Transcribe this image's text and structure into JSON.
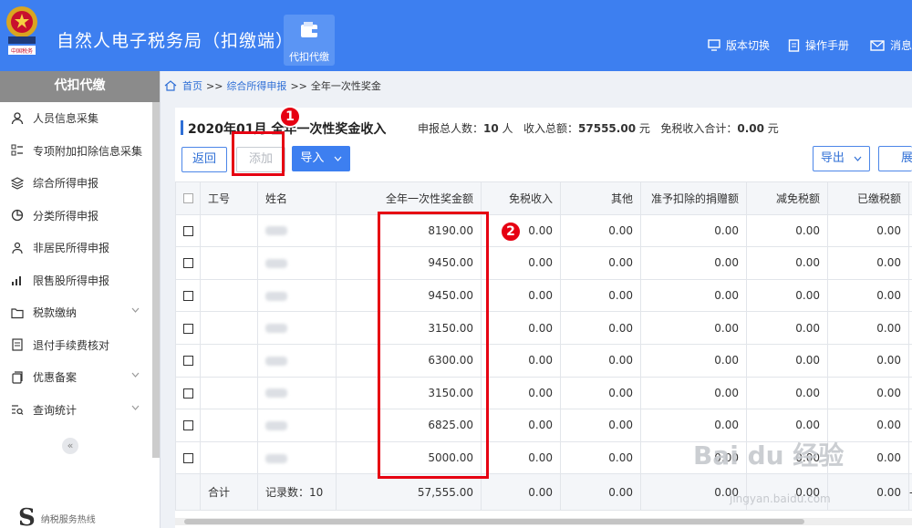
{
  "header": {
    "title": "自然人电子税务局（扣缴端）",
    "nav_button": "代扣代缴",
    "links": [
      "版本切换",
      "操作手册",
      "消息"
    ],
    "bg_color": "#3d7ff0"
  },
  "sidebar": {
    "title": "代扣代缴",
    "items": [
      {
        "label": "人员信息采集",
        "icon": "person-icon"
      },
      {
        "label": "专项附加扣除信息采集",
        "icon": "list-icon"
      },
      {
        "label": "综合所得申报",
        "icon": "layers-icon"
      },
      {
        "label": "分类所得申报",
        "icon": "pie-icon"
      },
      {
        "label": "非居民所得申报",
        "icon": "person-outline-icon"
      },
      {
        "label": "限售股所得申报",
        "icon": "bar-chart-icon"
      },
      {
        "label": "税款缴纳",
        "icon": "folder-icon",
        "expandable": true
      },
      {
        "label": "退付手续费核对",
        "icon": "document-icon"
      },
      {
        "label": "优惠备案",
        "icon": "copy-icon",
        "expandable": true
      },
      {
        "label": "查询统计",
        "icon": "search-list-icon",
        "expandable": true
      }
    ],
    "hotline": "纳税服务热线"
  },
  "breadcrumb": {
    "home": "首页",
    "sep": ">>",
    "level2": "综合所得申报",
    "current": "全年一次性奖金"
  },
  "page": {
    "title": "2020年01月 全年一次性奖金收入",
    "summary": {
      "count_label": "申报总人数：",
      "count_value": "10",
      "count_unit": "人",
      "income_label": "收入总额：",
      "income_value": "57555.00",
      "income_unit": "元",
      "exempt_label": "免税收入合计：",
      "exempt_value": "0.00",
      "exempt_unit": "元"
    }
  },
  "toolbar": {
    "back": "返回",
    "add": "添加",
    "import": "导入",
    "export": "导出",
    "more": "展"
  },
  "table": {
    "headers": [
      "工号",
      "姓名",
      "全年一次性奖金额",
      "免税收入",
      "其他",
      "准予扣除的捐赠额",
      "减免税额",
      "已缴税额"
    ],
    "rows": [
      {
        "bonus": "8190.00",
        "exempt": "0.00",
        "other": "0.00",
        "donation": "0.00",
        "relief": "0.00",
        "paid": "0.00"
      },
      {
        "bonus": "9450.00",
        "exempt": "0.00",
        "other": "0.00",
        "donation": "0.00",
        "relief": "0.00",
        "paid": "0.00"
      },
      {
        "bonus": "9450.00",
        "exempt": "0.00",
        "other": "0.00",
        "donation": "0.00",
        "relief": "0.00",
        "paid": "0.00"
      },
      {
        "bonus": "3150.00",
        "exempt": "0.00",
        "other": "0.00",
        "donation": "0.00",
        "relief": "0.00",
        "paid": "0.00"
      },
      {
        "bonus": "6300.00",
        "exempt": "0.00",
        "other": "0.00",
        "donation": "0.00",
        "relief": "0.00",
        "paid": "0.00"
      },
      {
        "bonus": "3150.00",
        "exempt": "0.00",
        "other": "0.00",
        "donation": "0.00",
        "relief": "0.00",
        "paid": "0.00"
      },
      {
        "bonus": "6825.00",
        "exempt": "0.00",
        "other": "0.00",
        "donation": "0.00",
        "relief": "0.00",
        "paid": "0.00"
      },
      {
        "bonus": "5000.00",
        "exempt": "0.00",
        "other": "0.00",
        "donation": "0.00",
        "relief": "0.00",
        "paid": "0.00"
      }
    ],
    "total": {
      "label": "合计",
      "records": "记录数：10",
      "bonus": "57,555.00",
      "exempt": "0.00",
      "other": "0.00",
      "donation": "0.00",
      "relief": "0.00",
      "paid": "0.00",
      "extra": "--"
    }
  },
  "annotations": {
    "one": "1",
    "two": "2",
    "color": "#e60012"
  },
  "watermark": {
    "brand": "Bai du 经验",
    "url": "jingyan.baidu.com"
  }
}
